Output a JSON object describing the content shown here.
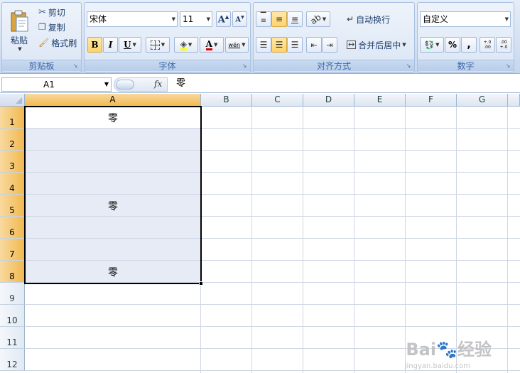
{
  "ribbon": {
    "clipboard": {
      "label": "剪贴板",
      "paste": "粘贴",
      "cut": "剪切",
      "copy": "复制",
      "format_painter": "格式刷"
    },
    "font": {
      "label": "字体",
      "font_name": "宋体",
      "font_size": "11",
      "grow": "A",
      "shrink": "A",
      "bold": "B",
      "italic": "I",
      "underline": "U",
      "font_color": "A",
      "phonetic": "wén"
    },
    "alignment": {
      "label": "对齐方式",
      "wrap_text": "自动换行",
      "merge_center": "合并后居中"
    },
    "number": {
      "label": "数字",
      "format": "自定义",
      "percent": "%",
      "comma": ",",
      "inc_decimal": "+.0 .00",
      "dec_decimal": ".00 +.0"
    }
  },
  "formula_bar": {
    "name_box": "A1",
    "fx": "fx",
    "value": "零"
  },
  "grid": {
    "columns": [
      "A",
      "B",
      "C",
      "D",
      "E",
      "F",
      "G"
    ],
    "rows": [
      "1",
      "2",
      "3",
      "4",
      "5",
      "6",
      "7",
      "8",
      "9",
      "10",
      "11",
      "12"
    ],
    "cells": {
      "A1": "零",
      "A5": "零",
      "A8": "零"
    }
  },
  "watermark": {
    "brand": "Bai",
    "brand_suffix": "经验",
    "url": "jingyan.baidu.com"
  },
  "colors": {
    "selected_header": "#f1b94f",
    "selection_fill": "#e7ebf5",
    "ribbon_text": "#15428b"
  }
}
